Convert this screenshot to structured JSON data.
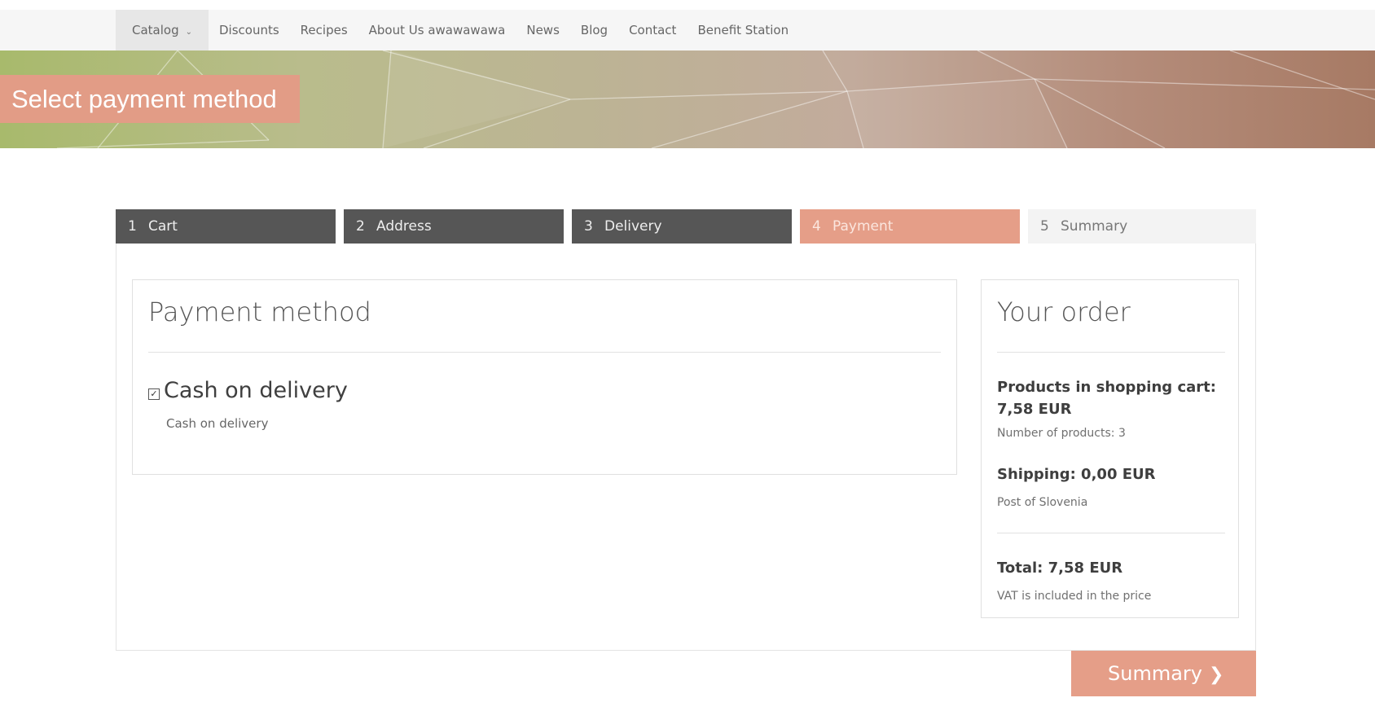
{
  "nav": {
    "items": [
      {
        "label": "Catalog",
        "has_dropdown": true,
        "active": true
      },
      {
        "label": "Discounts"
      },
      {
        "label": "Recipes"
      },
      {
        "label": "About Us awawawawa"
      },
      {
        "label": "News"
      },
      {
        "label": "Blog"
      },
      {
        "label": "Contact"
      },
      {
        "label": "Benefit Station"
      }
    ],
    "dropdown_icon": "chevron-down-icon"
  },
  "hero": {
    "title": "Select payment method",
    "badge_color": "#e29c86"
  },
  "steps": [
    {
      "number": "1",
      "label": "Cart",
      "state": "done"
    },
    {
      "number": "2",
      "label": "Address",
      "state": "done"
    },
    {
      "number": "3",
      "label": "Delivery",
      "state": "done"
    },
    {
      "number": "4",
      "label": "Payment",
      "state": "current"
    },
    {
      "number": "5",
      "label": "Summary",
      "state": "future"
    }
  ],
  "payment": {
    "title": "Payment method",
    "methods": [
      {
        "name": "Cash on delivery",
        "description": "Cash on delivery",
        "checked": true
      }
    ]
  },
  "order": {
    "title": "Your order",
    "products_line": "Products in shopping cart: 7,58 EUR",
    "products_count": "Number of products: 3",
    "shipping_line": "Shipping: 0,00 EUR",
    "shipping_provider": "Post of Slovenia",
    "total_line": "Total: 7,58 EUR",
    "vat_note": "VAT is included in the price"
  },
  "summary_button": {
    "label": "Summary",
    "icon": "chevron-right-icon"
  },
  "colors": {
    "accent": "#e59e88",
    "step_done": "#565656",
    "step_future": "#f3f3f3",
    "nav_bg": "#f6f6f6"
  }
}
